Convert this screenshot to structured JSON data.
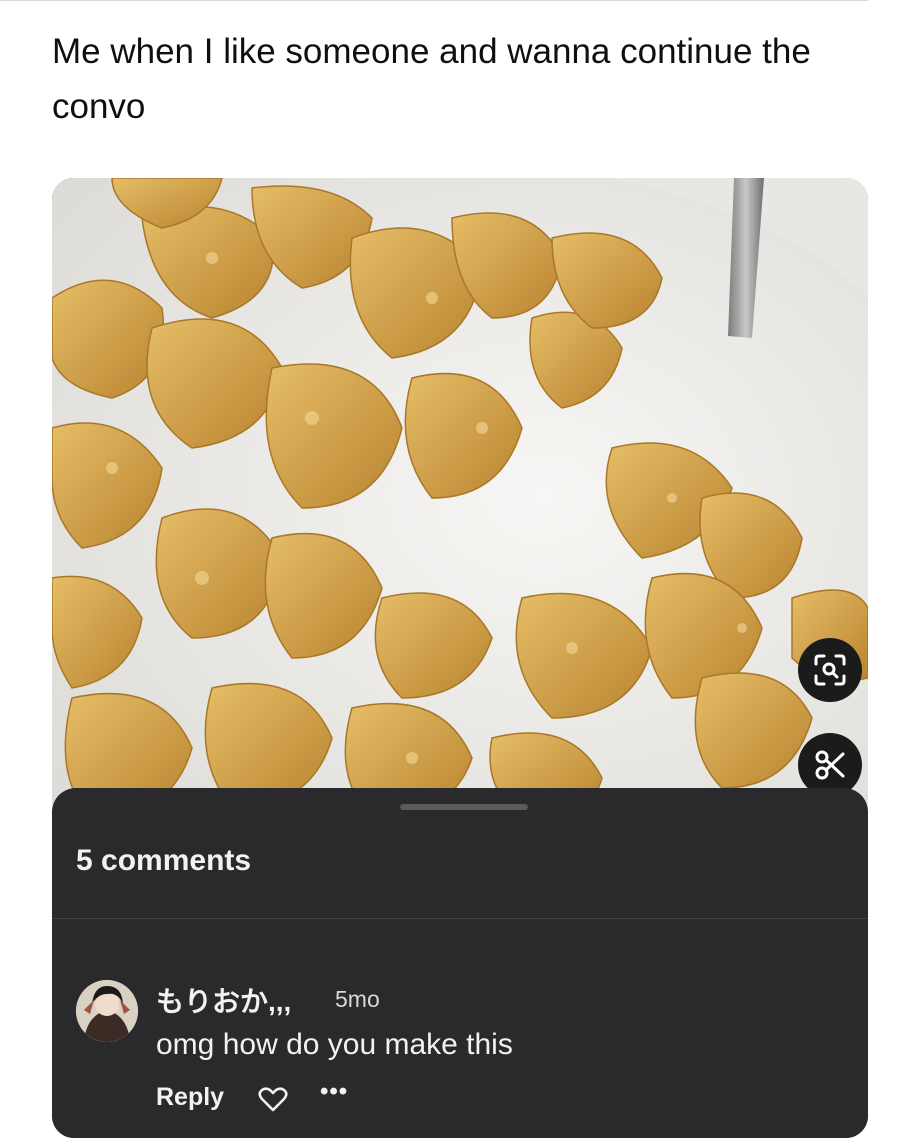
{
  "post": {
    "caption": "Me when I like someone and wanna continue the convo"
  },
  "image": {
    "subject": "bowl of frosted corn flakes in milk with a spoon",
    "colors": {
      "milk": "#f1f0ee",
      "flake": "#d6a84f",
      "flake_dark": "#b9862f",
      "spoon": "#9a9a9a"
    }
  },
  "overlay_buttons": {
    "lens_icon": "visual-search-icon",
    "scissor_icon": "scissors-icon"
  },
  "comments_sheet": {
    "count_label": "5 comments",
    "comment": {
      "username": "もりおか,,,",
      "timestamp": "5mo",
      "text": "omg how do you make this",
      "reply_label": "Reply",
      "like_icon": "heart-icon",
      "more_icon": "more-dots-icon"
    }
  },
  "colors": {
    "sheet_bg": "#2a2a2c",
    "text": "#f2f2f2",
    "divider": "#444446"
  }
}
